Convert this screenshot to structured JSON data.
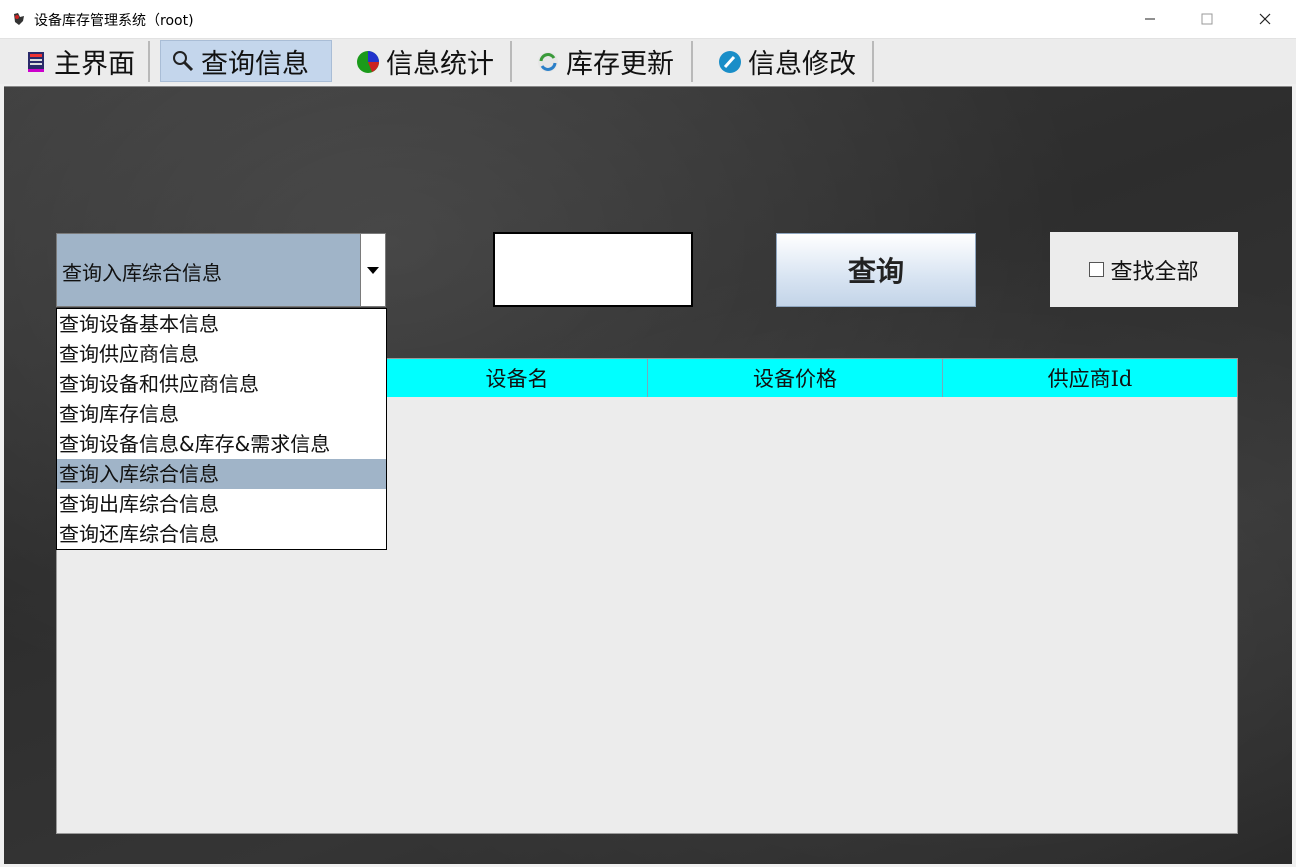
{
  "window": {
    "title": "设备库存管理系统（root)",
    "buttons": {
      "minimize": "—",
      "maximize": "☐",
      "close": "✕"
    }
  },
  "tabs": [
    {
      "label": "主界面",
      "icon": "book-icon"
    },
    {
      "label": "查询信息",
      "icon": "magnifier-icon",
      "selected": true
    },
    {
      "label": "信息统计",
      "icon": "pie-chart-icon"
    },
    {
      "label": "库存更新",
      "icon": "refresh-icon"
    },
    {
      "label": "信息修改",
      "icon": "edit-icon"
    }
  ],
  "query": {
    "combo_value": "查询入库综合信息",
    "options": [
      "查询设备基本信息",
      "查询供应商信息",
      "查询设备和供应商信息",
      "查询库存信息",
      "查询设备信息&库存&需求信息",
      "查询入库综合信息",
      "查询出库综合信息",
      "查询还库综合信息"
    ],
    "selected_option_index": 5,
    "search_value": "",
    "query_button": "查询",
    "find_all_label": "查找全部",
    "find_all_checked": false
  },
  "table": {
    "columns": [
      "",
      "设备名",
      "设备价格",
      "供应商Id"
    ],
    "rows": []
  },
  "colors": {
    "tab_selected": "#c4d6ec",
    "combo_bg": "#a0b4c8",
    "header_bg": "#00ffff"
  }
}
